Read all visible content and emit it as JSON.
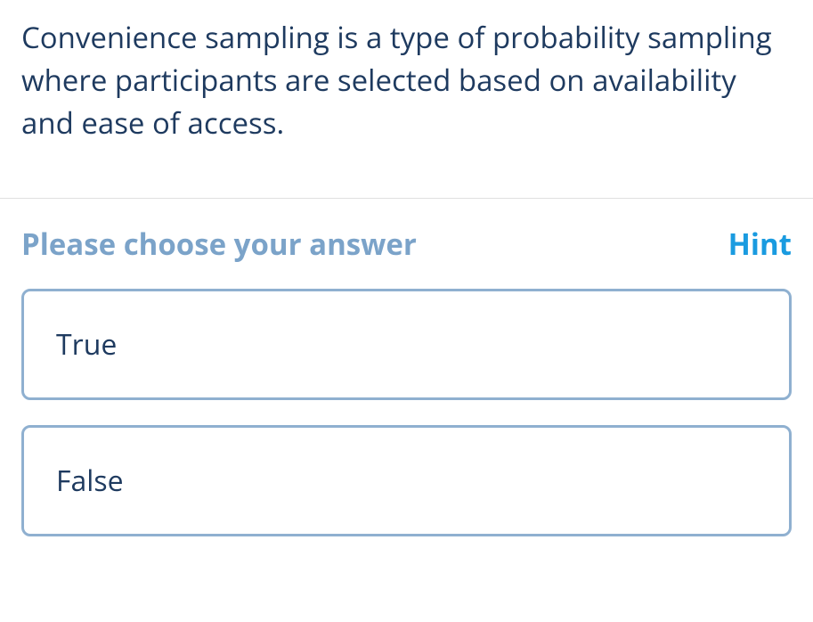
{
  "question": {
    "text": "Convenience sampling is a type of probability sampling where participants are selected based on availability and ease of access."
  },
  "answer": {
    "prompt": "Please choose your answer",
    "hint_label": "Hint",
    "options": [
      {
        "label": "True"
      },
      {
        "label": "False"
      }
    ]
  }
}
